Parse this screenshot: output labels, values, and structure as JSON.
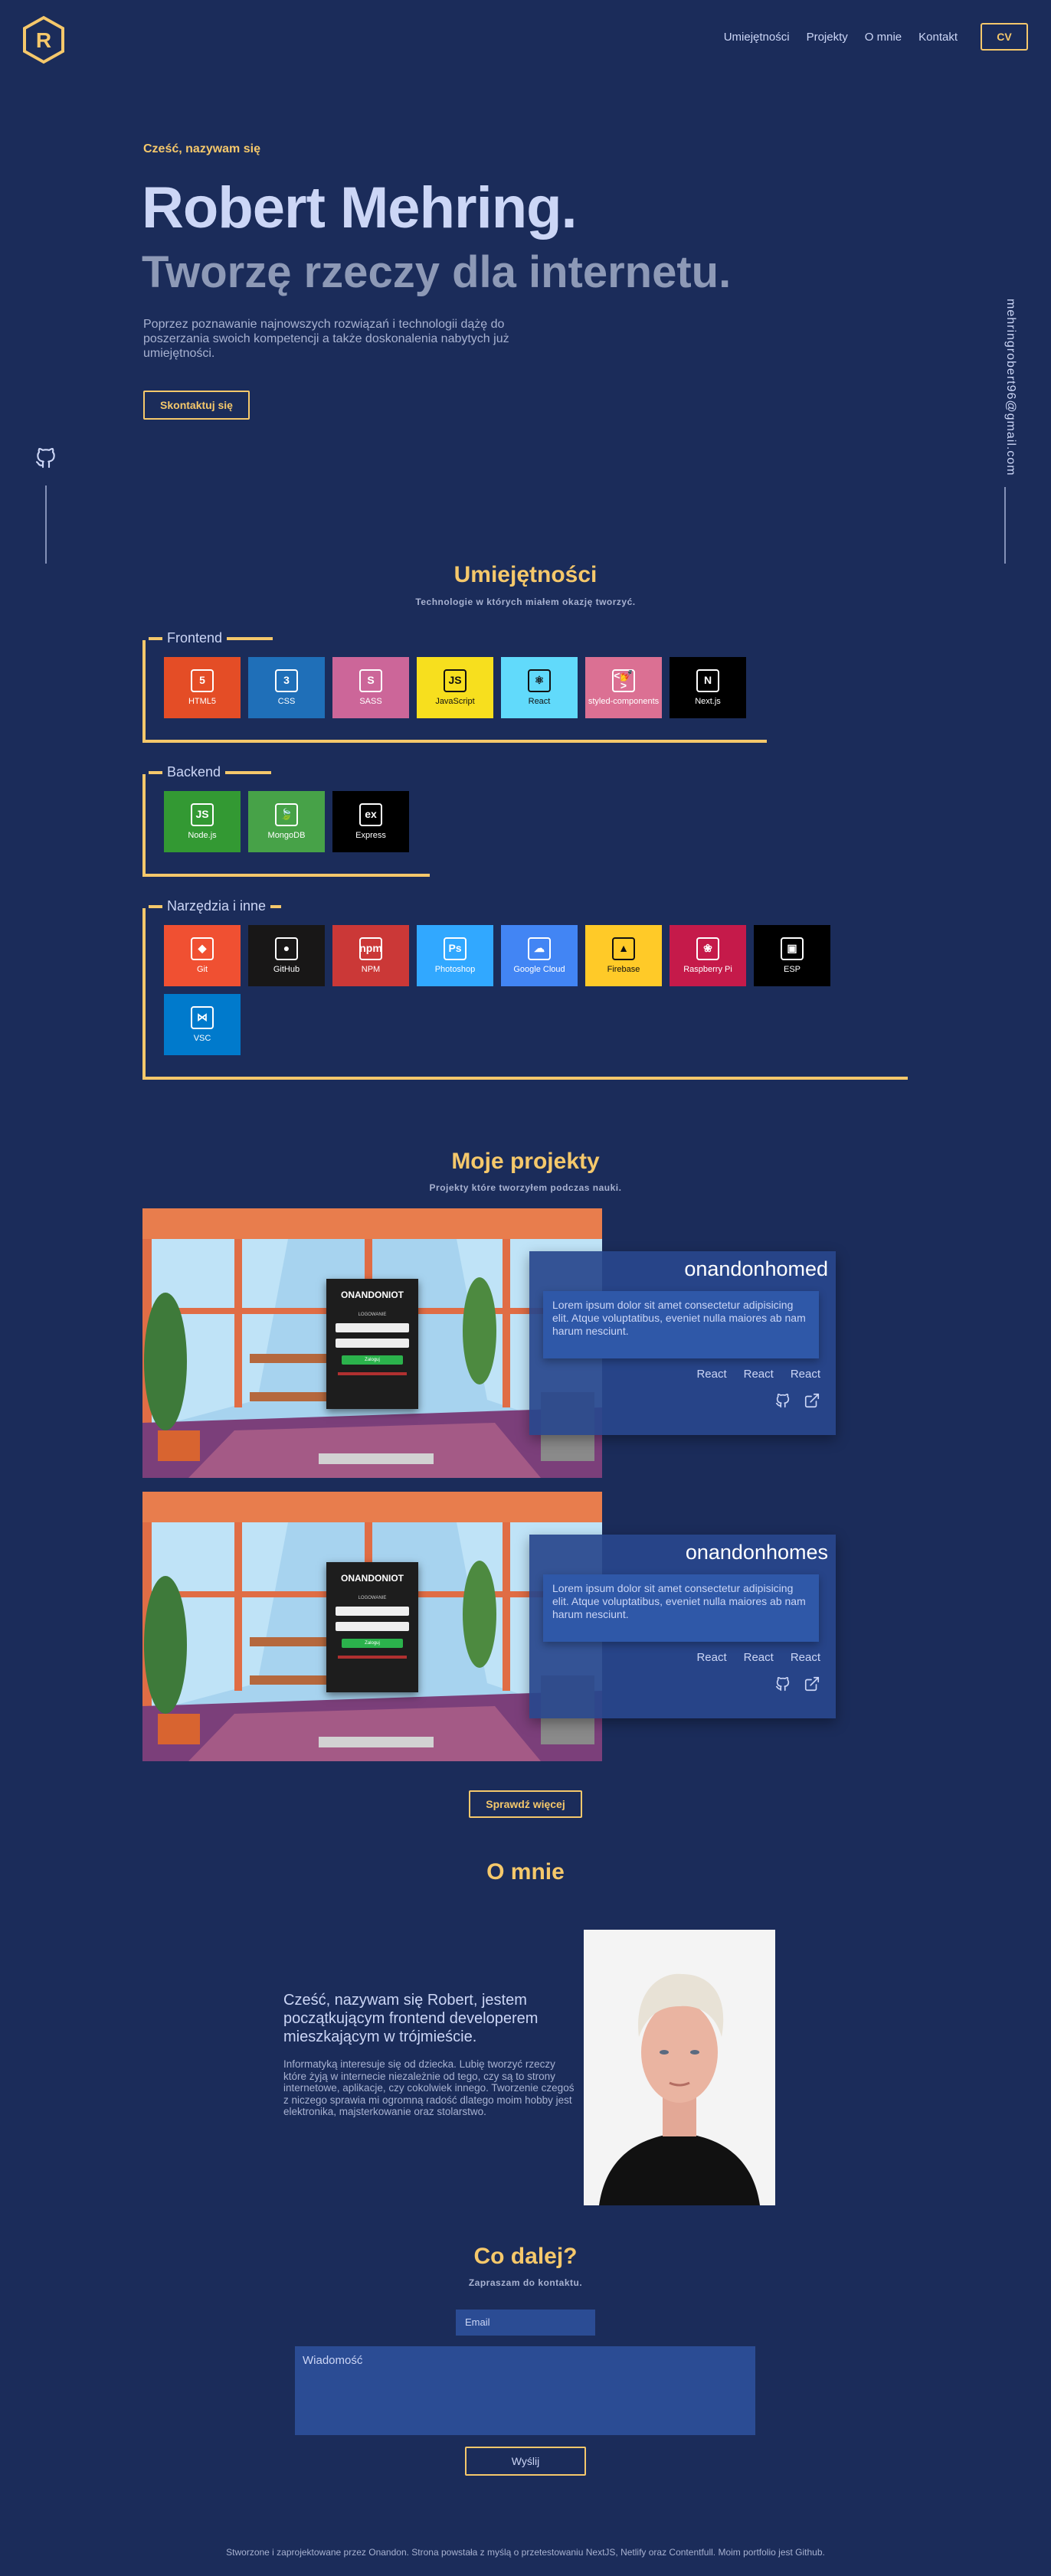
{
  "header": {
    "logo_letter": "R",
    "nav": [
      "Umiejętności",
      "Projekty",
      "O mnie",
      "Kontakt"
    ],
    "cv_label": "CV"
  },
  "side": {
    "github_icon": "github-icon",
    "email": "mehringrobert96@gmail.com"
  },
  "hero": {
    "greeting": "Cześć, nazywam się",
    "name": "Robert Mehring.",
    "tagline": "Tworzę rzeczy dla internetu.",
    "description": "Poprzez poznawanie najnowszych rozwiązań i technologii dążę do poszerzania swoich kompetencji a także doskonalenia nabytych już umiejętności.",
    "cta": "Skontaktuj się"
  },
  "skills": {
    "title": "Umiejętności",
    "subtitle": "Technologie w których miałem okazję tworzyć.",
    "groups": [
      {
        "label": "Frontend",
        "items": [
          {
            "name": "HTML5",
            "color": "#e44d26",
            "icon": "html5-icon",
            "glyph": "5"
          },
          {
            "name": "CSS",
            "color": "#1f6fb8",
            "icon": "css-icon",
            "glyph": "3"
          },
          {
            "name": "SASS",
            "color": "#cc6699",
            "icon": "sass-icon",
            "glyph": "S"
          },
          {
            "name": "JavaScript",
            "color": "#f7df1e",
            "icon": "javascript-icon",
            "glyph": "JS"
          },
          {
            "name": "React",
            "color": "#61dafb",
            "icon": "react-icon",
            "glyph": "⚛"
          },
          {
            "name": "styled-components",
            "color": "#db7093",
            "icon": "styled-components-icon",
            "glyph": "<💅>"
          },
          {
            "name": "Next.js",
            "color": "#000000",
            "icon": "nextjs-icon",
            "glyph": "N"
          }
        ]
      },
      {
        "label": "Backend",
        "items": [
          {
            "name": "Node.js",
            "color": "#339933",
            "icon": "nodejs-icon",
            "glyph": "JS"
          },
          {
            "name": "MongoDB",
            "color": "#47a248",
            "icon": "mongodb-icon",
            "glyph": "🍃"
          },
          {
            "name": "Express",
            "color": "#000000",
            "icon": "express-icon",
            "glyph": "ex"
          }
        ]
      },
      {
        "label": "Narzędzia i inne",
        "items": [
          {
            "name": "Git",
            "color": "#f05032",
            "icon": "git-icon",
            "glyph": "◆"
          },
          {
            "name": "GitHub",
            "color": "#181717",
            "icon": "github-icon",
            "glyph": "●"
          },
          {
            "name": "NPM",
            "color": "#cb3837",
            "icon": "npm-icon",
            "glyph": "npm"
          },
          {
            "name": "Photoshop",
            "color": "#31a8ff",
            "icon": "photoshop-icon",
            "glyph": "Ps"
          },
          {
            "name": "Google Cloud",
            "color": "#4285f4",
            "icon": "google-cloud-icon",
            "glyph": "☁"
          },
          {
            "name": "Firebase",
            "color": "#ffca28",
            "icon": "firebase-icon",
            "glyph": "▲"
          },
          {
            "name": "Raspberry Pi",
            "color": "#c51a4a",
            "icon": "raspberry-pi-icon",
            "glyph": "❀"
          },
          {
            "name": "ESP",
            "color": "#000000",
            "icon": "esp-icon",
            "glyph": "▣"
          },
          {
            "name": "VSC",
            "color": "#007acc",
            "icon": "vscode-icon",
            "glyph": "⋈"
          }
        ]
      }
    ]
  },
  "projects": {
    "title": "Moje projekty",
    "subtitle": "Projekty które tworzyłem podczas nauki.",
    "items": [
      {
        "title": "onandonhomed",
        "description": "Lorem ipsum dolor sit amet consectetur adipisicing elit. Atque voluptatibus, eveniet nulla maiores ab nam harum nesciunt.",
        "tags": [
          "React",
          "React",
          "React"
        ],
        "mock_brand": "ONANDONIOT",
        "mock_login_label": "LOGOWANIE",
        "mock_button": "Zaloguj"
      },
      {
        "title": "onandonhomes",
        "description": "Lorem ipsum dolor sit amet consectetur adipisicing elit. Atque voluptatibus, eveniet nulla maiores ab nam harum nesciunt.",
        "tags": [
          "React",
          "React",
          "React"
        ],
        "mock_brand": "ONANDONIOT",
        "mock_login_label": "LOGOWANIE",
        "mock_button": "Zaloguj"
      }
    ],
    "more_label": "Sprawdź więcej"
  },
  "about": {
    "title": "O mnie",
    "lead": "Cześć, nazywam się Robert, jestem początkującym frontend developerem mieszkającym w trójmieście.",
    "text": "Informatyką interesuje się od dziecka. Lubię tworzyć rzeczy które żyją w internecie niezależnie od tego, czy są to strony internetowe, aplikacje, czy cokolwiek innego. Tworzenie czegoś z niczego sprawia mi ogromną radość dlatego moim hobby jest elektronika, majsterkowanie oraz stolarstwo."
  },
  "contact": {
    "title": "Co dalej?",
    "subtitle": "Zapraszam do kontaktu.",
    "email_placeholder": "Email",
    "message_placeholder": "Wiadomość",
    "send_label": "Wyślij"
  },
  "footer": {
    "text": "Stworzone i zaprojektowane przez Onandon. Strona powstała z myślą o przetestowaniu NextJS, Netlify oraz Contentfull. Moim portfolio jest Github."
  }
}
